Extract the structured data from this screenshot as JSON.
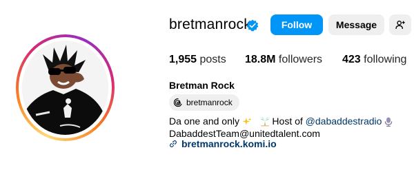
{
  "profile": {
    "username": "bretmanrock",
    "full_name": "Bretman Rock",
    "verified": true
  },
  "actions": {
    "follow_label": "Follow",
    "message_label": "Message",
    "suggest_icon": "person-add-icon"
  },
  "stats": {
    "posts_value": "1,955",
    "posts_label": "posts",
    "followers_value": "18.8M",
    "followers_label": "followers",
    "following_value": "423",
    "following_label": "following"
  },
  "threads": {
    "icon": "threads-icon",
    "handle": "bretmanrock"
  },
  "bio": {
    "line1_prefix": "Da one and only",
    "line1_mid": "Host of",
    "line1_mention": "@dabaddestradio",
    "line2": "DabaddestTeam@unitedtalent.com"
  },
  "link": {
    "icon": "link-icon",
    "text": "bretmanrock.komi.io"
  },
  "colors": {
    "follow_blue": "#0095f6",
    "secondary_button": "#efefef",
    "link": "#00376b",
    "verified_blue": "#0095f6"
  }
}
